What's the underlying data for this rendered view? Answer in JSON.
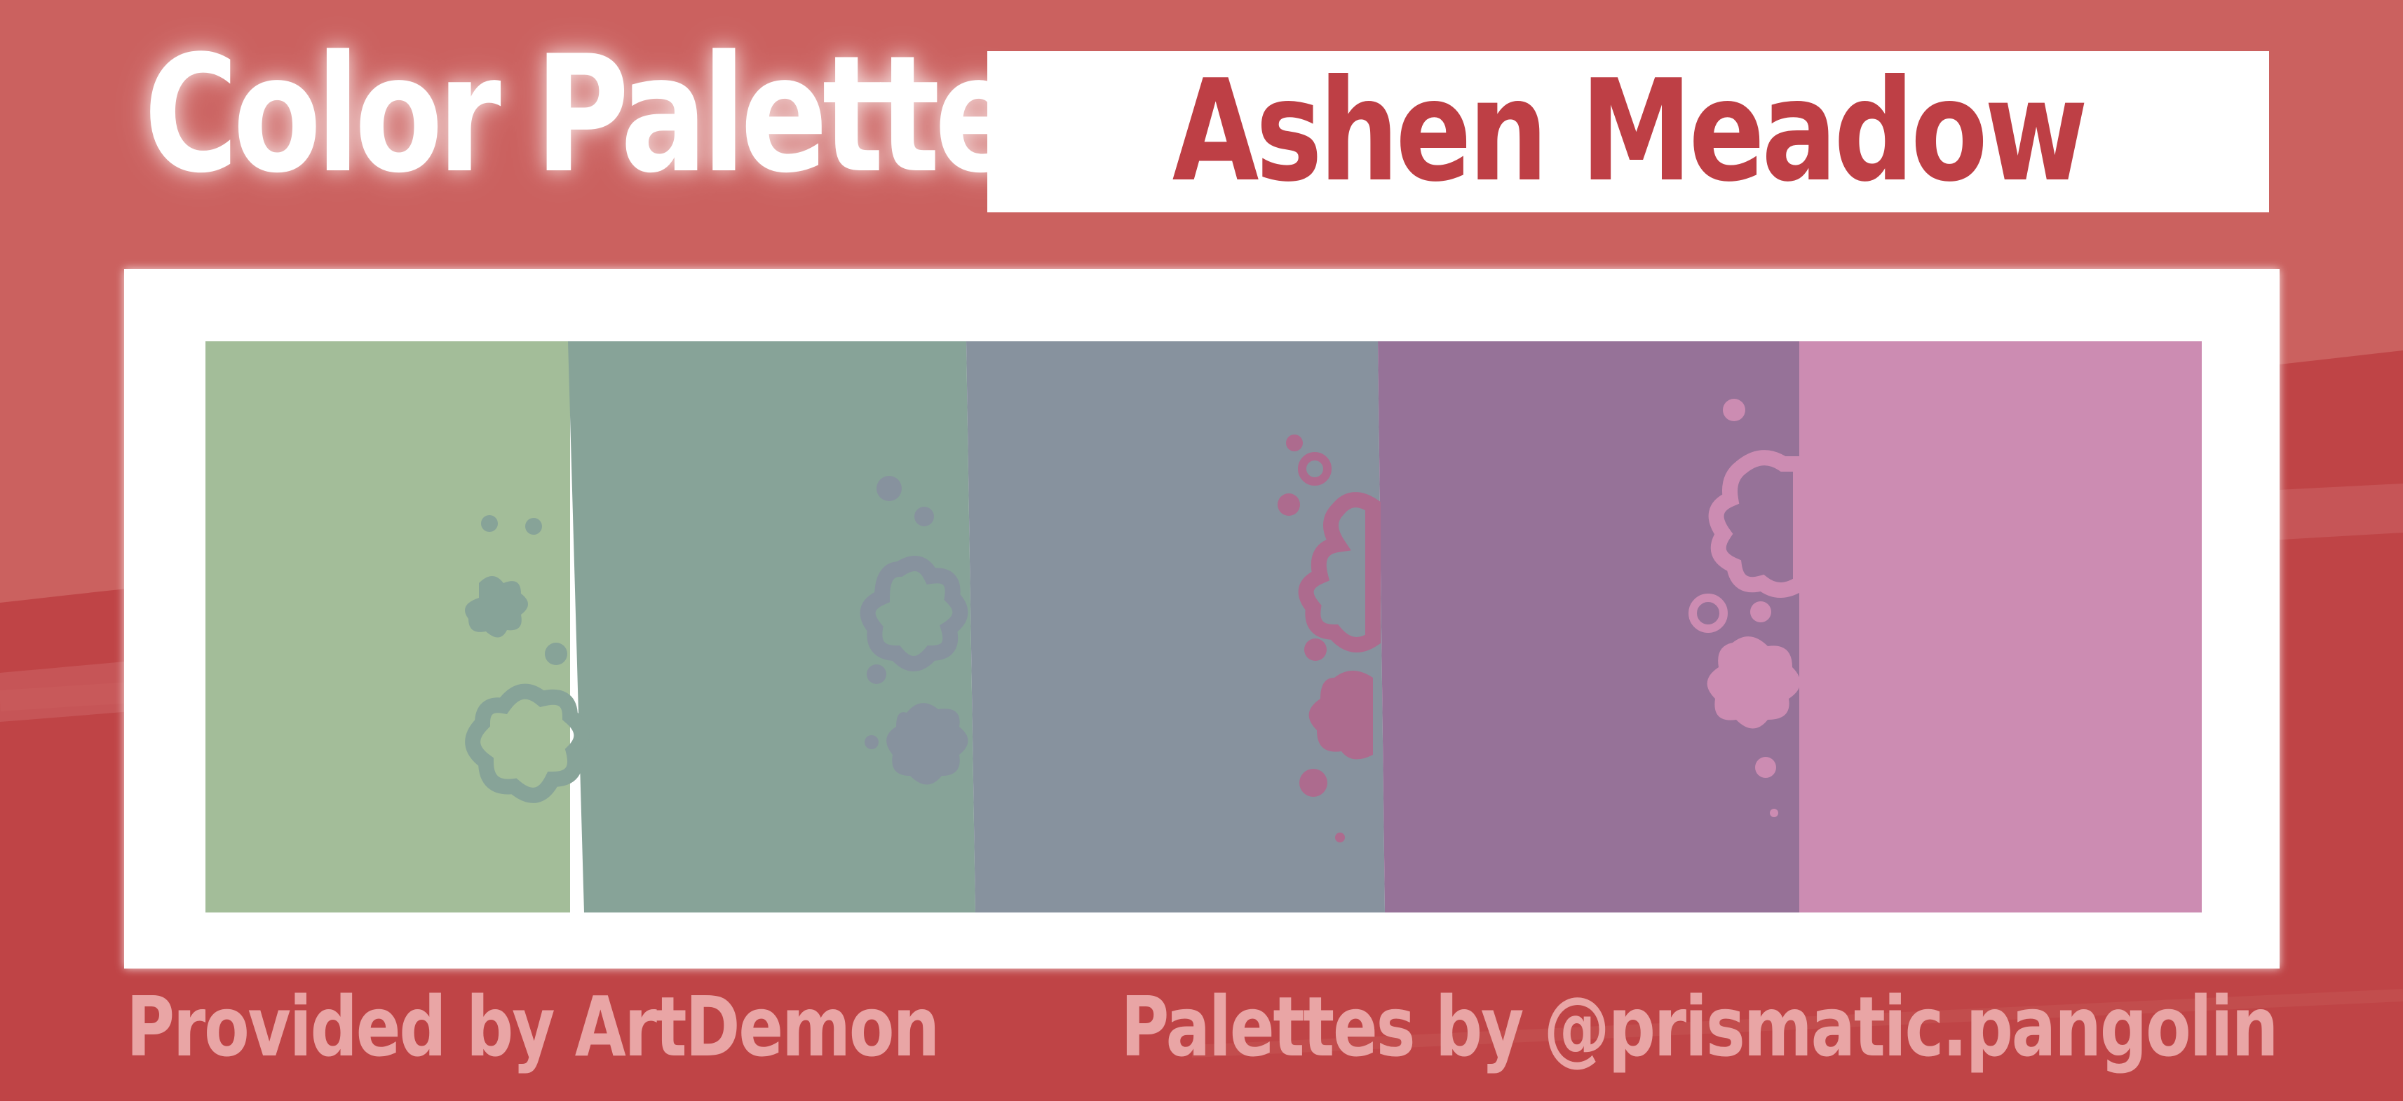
{
  "header": {
    "title": "Color Palette",
    "palette_name": "Ashen Meadow"
  },
  "palette": {
    "swatches": [
      {
        "name": "swatch-1",
        "color": "#a3bd99"
      },
      {
        "name": "swatch-2",
        "color": "#87a398"
      },
      {
        "name": "swatch-3",
        "color": "#87929e"
      },
      {
        "name": "swatch-4",
        "color": "#967298"
      },
      {
        "name": "swatch-5",
        "color": "#cc8cb2"
      }
    ]
  },
  "footer": {
    "credit": "Provided by ArtDemon",
    "author": "Palettes by @prismatic.pangolin"
  },
  "colors": {
    "background": "#cb615f",
    "background_band": "#bf4446",
    "accent_text": "#be3f45",
    "footer_text": "#e9a5a5",
    "frame": "#ffffff"
  }
}
